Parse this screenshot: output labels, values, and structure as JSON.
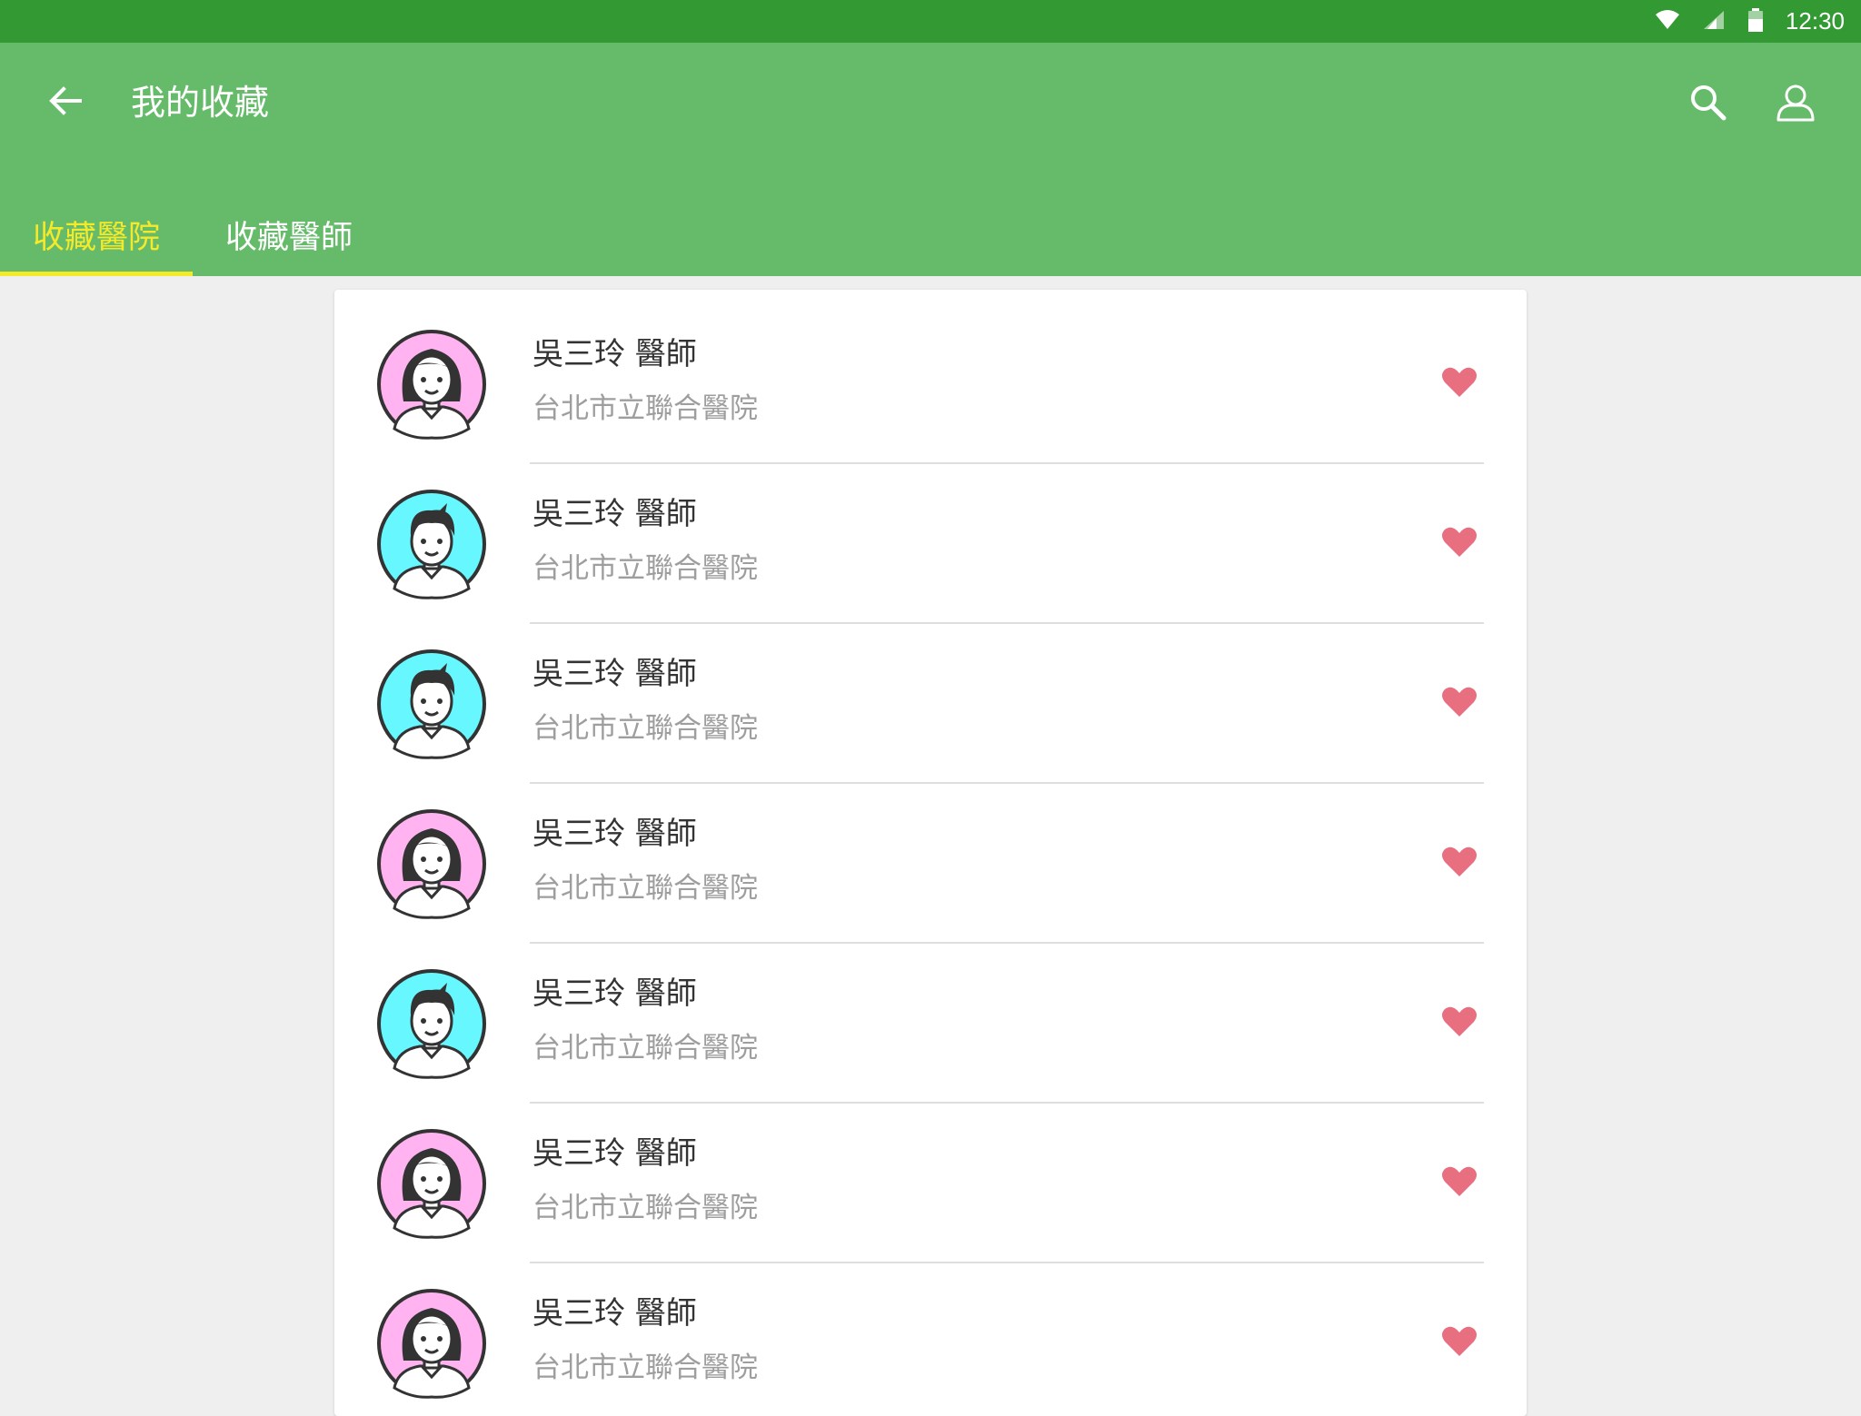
{
  "status_bar": {
    "time": "12:30"
  },
  "app_bar": {
    "title": "我的收藏"
  },
  "tabs": [
    {
      "label": "收藏醫院",
      "active": true
    },
    {
      "label": "收藏醫師",
      "active": false
    }
  ],
  "favorites": [
    {
      "name": "吳三玲 醫師",
      "hospital": "台北市立聯合醫院",
      "avatar": "female-doctor-avatar"
    },
    {
      "name": "吳三玲 醫師",
      "hospital": "台北市立聯合醫院",
      "avatar": "male-doctor-avatar"
    },
    {
      "name": "吳三玲 醫師",
      "hospital": "台北市立聯合醫院",
      "avatar": "male-doctor-avatar"
    },
    {
      "name": "吳三玲 醫師",
      "hospital": "台北市立聯合醫院",
      "avatar": "female-doctor-avatar"
    },
    {
      "name": "吳三玲 醫師",
      "hospital": "台北市立聯合醫院",
      "avatar": "male-doctor-avatar"
    },
    {
      "name": "吳三玲 醫師",
      "hospital": "台北市立聯合醫院",
      "avatar": "female-doctor-avatar"
    },
    {
      "name": "吳三玲 醫師",
      "hospital": "台北市立聯合醫院",
      "avatar": "female-doctor-avatar"
    }
  ],
  "colors": {
    "status_bar": "#339933",
    "app_bar": "#66bb6a",
    "active_tab": "#f4ea2a",
    "heart": "#e76f80",
    "female_avatar_bg": "#ffb3f0",
    "male_avatar_bg": "#66f7ff"
  }
}
